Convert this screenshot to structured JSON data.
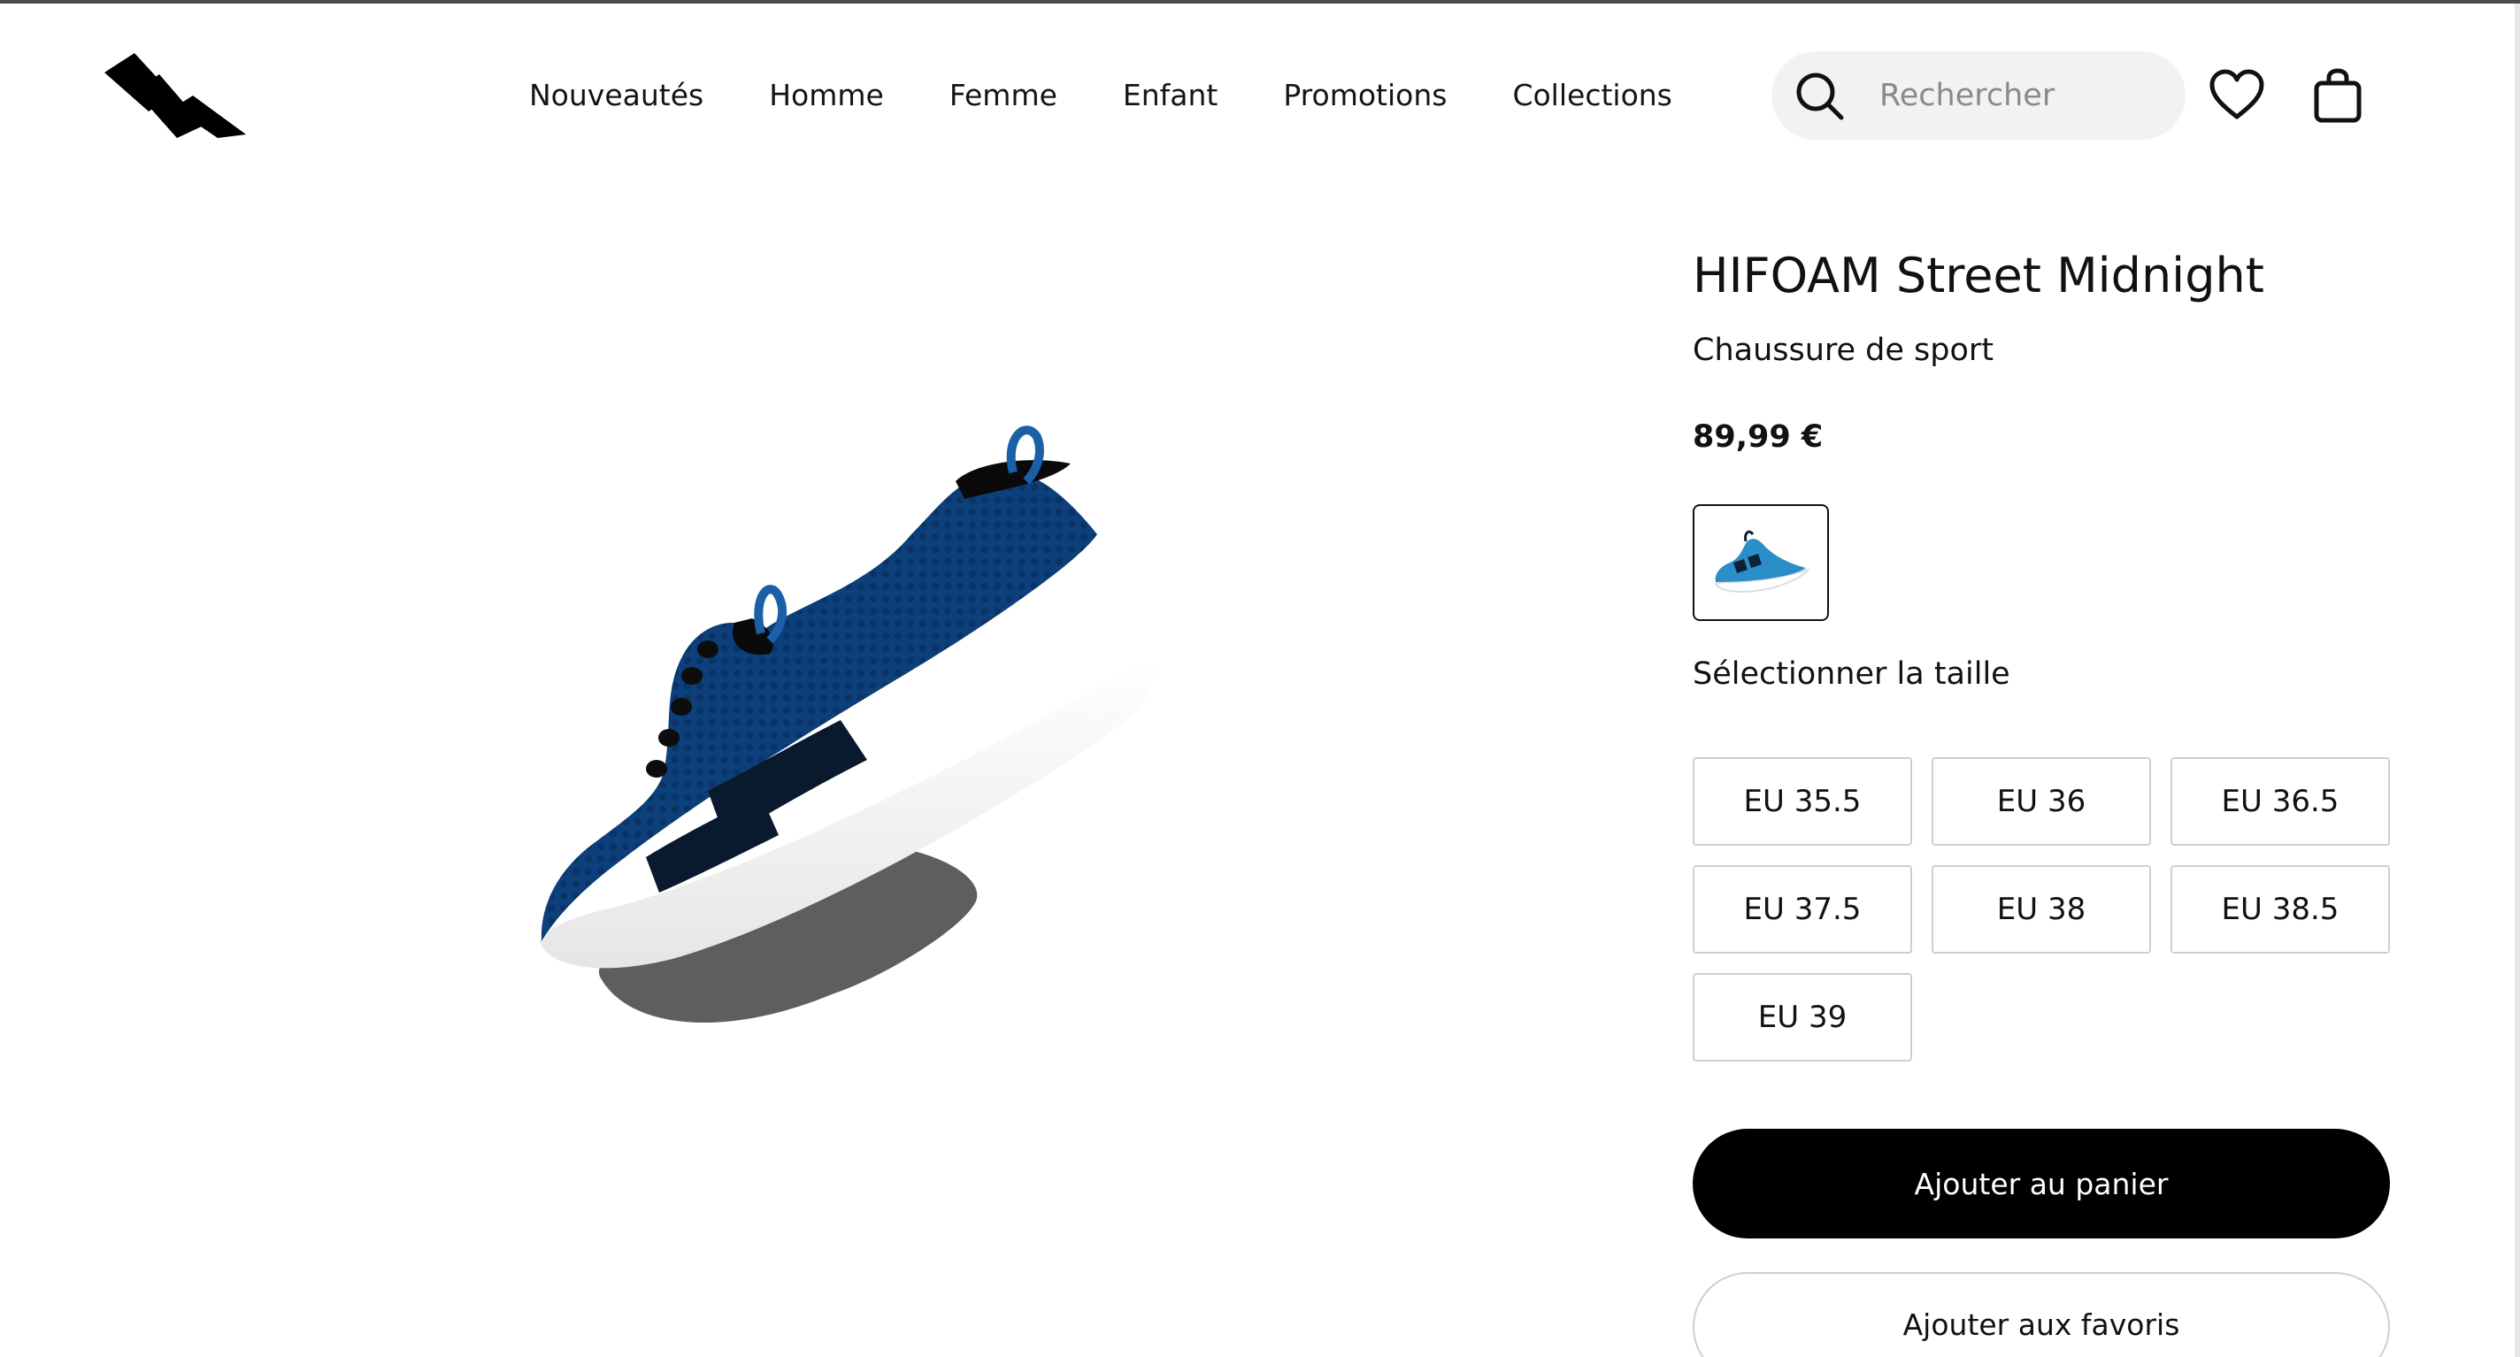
{
  "header": {
    "logo_icon": "brand-logo-stripes",
    "nav": [
      {
        "label": "Nouveautés"
      },
      {
        "label": "Homme"
      },
      {
        "label": "Femme"
      },
      {
        "label": "Enfant"
      },
      {
        "label": "Promotions"
      },
      {
        "label": "Collections"
      }
    ],
    "search": {
      "placeholder": "Rechercher",
      "icon": "search-icon"
    },
    "favorites_icon": "heart-icon",
    "bag_icon": "shopping-bag-icon"
  },
  "product": {
    "title": "HIFOAM Street Midnight",
    "subtitle": "Chaussure de sport",
    "price": "89,99 €",
    "visual": {
      "icon": "sneaker-3d-render",
      "upper_color": "#0d3f7a",
      "sole_color": "#ffffff",
      "accent_color": "#0a1a2e"
    },
    "color_variants": [
      {
        "selected": true,
        "upper_color": "#2a8fc9"
      }
    ],
    "size_label": "Sélectionner la taille",
    "sizes": [
      {
        "label": "EU 35.5"
      },
      {
        "label": "EU 36"
      },
      {
        "label": "EU 36.5"
      },
      {
        "label": "EU 37.5"
      },
      {
        "label": "EU 38"
      },
      {
        "label": "EU 38.5"
      },
      {
        "label": "EU 39"
      }
    ],
    "add_to_cart_label": "Ajouter au panier",
    "add_to_favorites_label": "Ajouter aux favoris"
  },
  "colors": {
    "primary_button_bg": "#000000",
    "primary_button_text": "#ffffff",
    "search_bg": "#f2f2f2",
    "border": "#cfcfcf"
  }
}
